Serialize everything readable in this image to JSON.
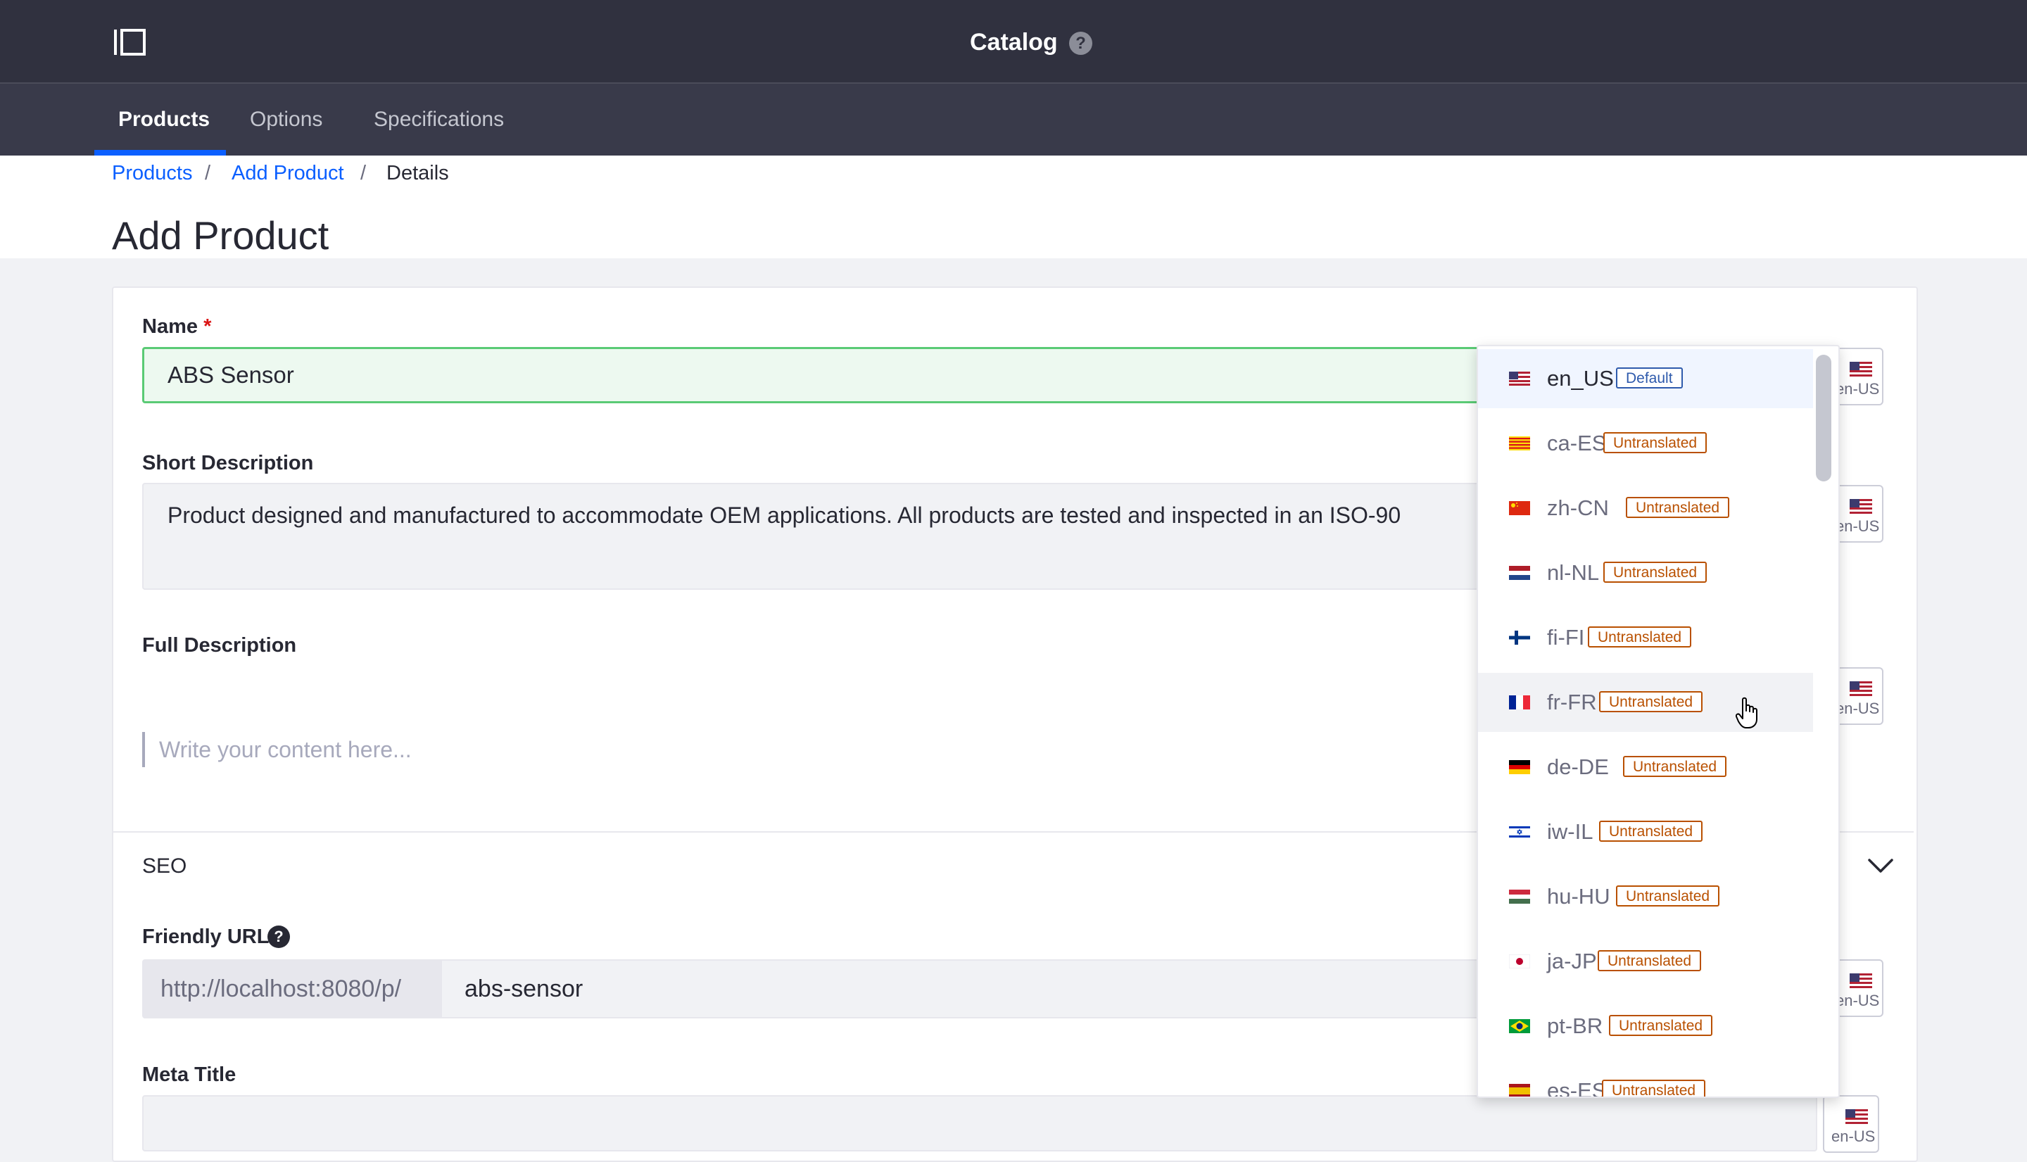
{
  "topbar": {
    "title": "Catalog",
    "help": "?"
  },
  "nav": {
    "tabs": [
      {
        "label": "Products"
      },
      {
        "label": "Options"
      },
      {
        "label": "Specifications"
      }
    ]
  },
  "breadcrumb": {
    "items": [
      "Products",
      "Add Product",
      "Details"
    ],
    "separator": "/"
  },
  "page": {
    "title": "Add Product"
  },
  "form": {
    "name_label": "Name",
    "required_mark": "*",
    "name_value": "ABS Sensor",
    "short_desc_label": "Short Description",
    "short_desc_value": "Product designed and manufactured to accommodate OEM applications. All products are tested and inspected in an ISO-90",
    "full_desc_label": "Full Description",
    "full_desc_placeholder": "Write your content here...",
    "seo_label": "SEO",
    "friendly_url_label": "Friendly URL",
    "friendly_url_help": "?",
    "friendly_url_prefix": "http://localhost:8080/p/",
    "friendly_url_value": "abs-sensor",
    "meta_title_label": "Meta Title"
  },
  "locale_button": {
    "label": "en-US",
    "flag": "us-flag-icon"
  },
  "locale_dropdown": {
    "items": [
      {
        "code": "en_US",
        "status": "Default",
        "flag": "us-flag-icon",
        "selected": true
      },
      {
        "code": "ca-ES",
        "status": "Untranslated",
        "flag": "catalonia-flag-icon"
      },
      {
        "code": "zh-CN",
        "status": "Untranslated",
        "flag": "china-flag-icon"
      },
      {
        "code": "nl-NL",
        "status": "Untranslated",
        "flag": "netherlands-flag-icon"
      },
      {
        "code": "fi-FI",
        "status": "Untranslated",
        "flag": "finland-flag-icon"
      },
      {
        "code": "fr-FR",
        "status": "Untranslated",
        "flag": "france-flag-icon",
        "hovered": true
      },
      {
        "code": "de-DE",
        "status": "Untranslated",
        "flag": "germany-flag-icon"
      },
      {
        "code": "iw-IL",
        "status": "Untranslated",
        "flag": "israel-flag-icon"
      },
      {
        "code": "hu-HU",
        "status": "Untranslated",
        "flag": "hungary-flag-icon"
      },
      {
        "code": "ja-JP",
        "status": "Untranslated",
        "flag": "japan-flag-icon"
      },
      {
        "code": "pt-BR",
        "status": "Untranslated",
        "flag": "brazil-flag-icon"
      },
      {
        "code": "es-ES",
        "status": "Untranslated",
        "flag": "spain-flag-icon"
      }
    ]
  },
  "colors": {
    "primary": "#0b5fff",
    "topbar": "#30313f",
    "navbar": "#393a4a",
    "success": "#5aca75",
    "warning": "#b95000",
    "info": "#2e5aac"
  }
}
